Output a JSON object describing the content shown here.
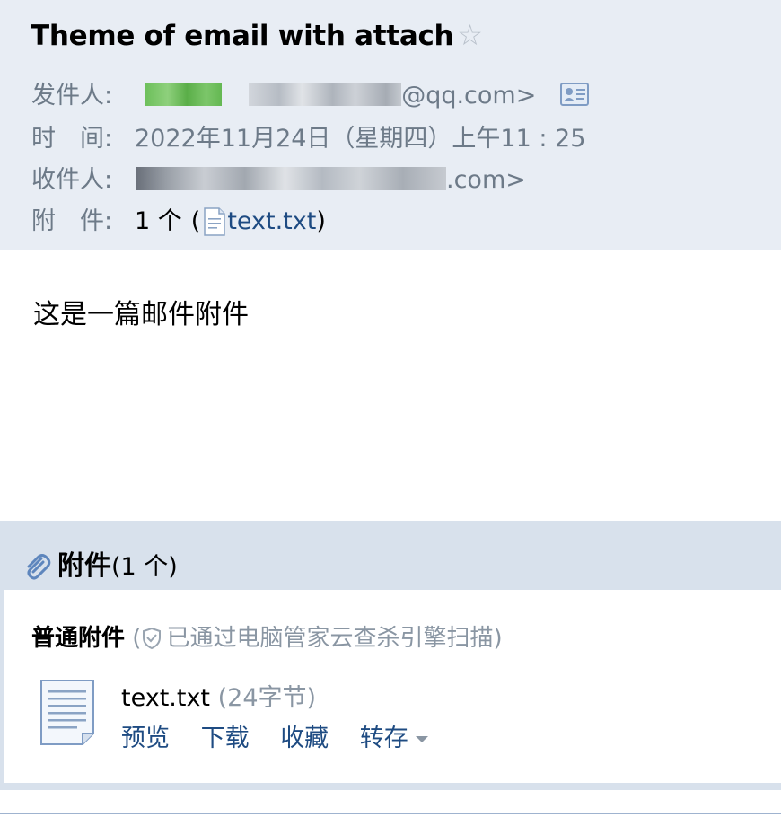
{
  "header": {
    "subject": "Theme of email with attach",
    "star_icon": "star-outline-icon",
    "sender": {
      "label": "发件人:",
      "address_suffix": "@qq.com>"
    },
    "time": {
      "label": "时　间:",
      "value": "2022年11月24日（星期四）上午11 : 25"
    },
    "recipient": {
      "label": "收件人:",
      "address_suffix": ".com>"
    },
    "attachments": {
      "label": "附　件:",
      "count": "1 个",
      "open_paren": "(",
      "file": "text.txt",
      "close_paren": ")"
    }
  },
  "body": {
    "text": "这是一篇邮件附件"
  },
  "attachment_section": {
    "title": "附件",
    "count": "(1 个)",
    "normal_label": "普通附件",
    "scan_note": "已通过电脑管家云查杀引擎扫描",
    "scan_open": "(",
    "scan_close": ")",
    "file": {
      "name": "text.txt",
      "size": "(24字节)",
      "actions": {
        "preview": "预览",
        "download": "下载",
        "favorite": "收藏",
        "save_to": "转存"
      }
    }
  },
  "colors": {
    "header_bg": "#e8edf4",
    "attachment_bar_bg": "#d8e1ec",
    "link": "#1e4b82",
    "muted": "#6d7a88"
  }
}
